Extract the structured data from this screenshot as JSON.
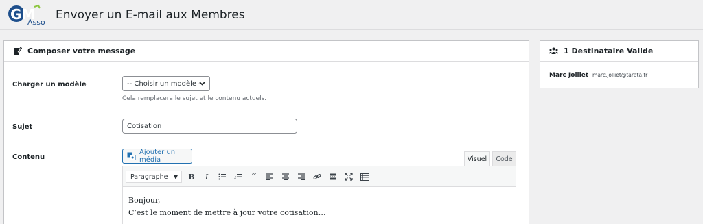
{
  "header": {
    "logo": {
      "letters": "GM",
      "sub": "Asso",
      "colors": {
        "primary": "#1e4f8c",
        "accent": "#8cc63f"
      }
    },
    "title": "Envoyer un E-mail aux Membres"
  },
  "compose": {
    "title": "Composer votre message",
    "icon": "edit-icon",
    "template": {
      "label": "Charger un modèle",
      "selected": "-- Choisir un modèle --",
      "hint": "Cela remplacera le sujet et le contenu actuels."
    },
    "subject": {
      "label": "Sujet",
      "value": "Cotisation"
    },
    "content": {
      "label": "Contenu",
      "add_media": "Ajouter un média",
      "tabs": {
        "visual": "Visuel",
        "code": "Code"
      },
      "format": "Paragraphe",
      "toolbar_icons": [
        "bold-icon",
        "italic-icon",
        "bullet-list-icon",
        "numbered-list-icon",
        "blockquote-icon",
        "align-left-icon",
        "align-center-icon",
        "align-right-icon",
        "link-icon",
        "read-more-icon",
        "fullscreen-icon",
        "toolbar-toggle-icon"
      ],
      "line1": "Bonjour,",
      "line2a": "C’est le moment de mettre à jour votre cotisat",
      "line2b": "ion…"
    }
  },
  "recipients": {
    "title": "1 Destinataire Valide",
    "icon": "users-icon",
    "items": [
      {
        "name": "Marc Jolliet",
        "email": "marc.jolliet@tarata.fr"
      }
    ]
  },
  "colors": {
    "link": "#2271b1",
    "border": "#c3c4c7",
    "background": "#f0f0f1"
  }
}
